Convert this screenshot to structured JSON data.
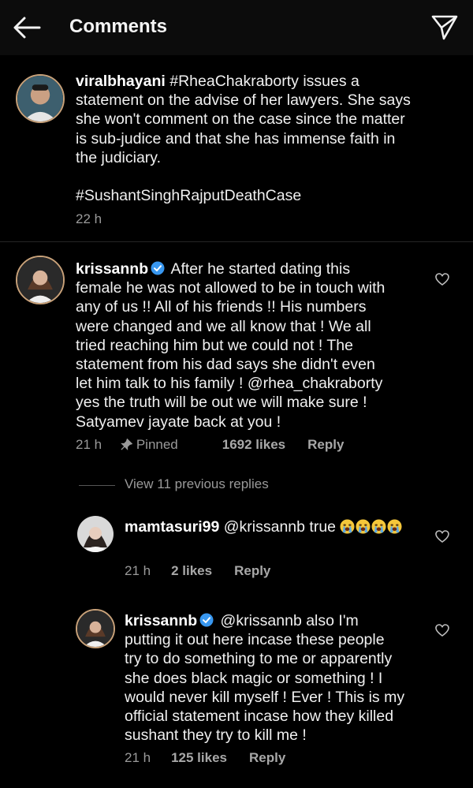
{
  "header": {
    "title": "Comments",
    "back_icon": "arrow-left-icon",
    "send_icon": "paper-plane-icon"
  },
  "caption": {
    "username": "viralbhayani",
    "text": "#RheaChakraborty issues a\nstatement on the advise of her lawyers. She says\nshe won't comment on the case since the matter\nis sub-judice and that she has immense faith in\nthe judiciary.\n\n#SushantSinghRajputDeathCase",
    "time": "22 h"
  },
  "comments": [
    {
      "username": "krissannb",
      "verified": true,
      "text": "After he started dating this\nfemale he was not allowed to be in touch with\nany of us !! All of his friends !! His numbers\nwere changed and we all know that ! We all\ntried reaching him but we could not ! The\nstatement from his dad says she didn't even\nlet him talk to his family ! @rhea_chakraborty\nyes the truth will be out we will make sure !\nSatyamev jayate back at you !",
      "time": "21 h",
      "pinned_label": "Pinned",
      "likes": "1692 likes",
      "reply_label": "Reply"
    }
  ],
  "view_replies_label": "View 11 previous replies",
  "replies": [
    {
      "username": "mamtasuri99",
      "text": "@krissannb true",
      "emoji_count": 4,
      "time": "21 h",
      "likes": "2 likes",
      "reply_label": "Reply"
    },
    {
      "username": "krissannb",
      "verified": true,
      "text": "@krissannb also I'm\nputting it out here incase these people\ntry to do something to me or apparently\nshe does black magic or something ! I\nwould never kill myself ! Ever ! This is my\nofficial statement incase how they killed\nsushant they try to kill me !",
      "time": "21 h",
      "likes": "125 likes",
      "reply_label": "Reply"
    }
  ],
  "colors": {
    "background": "#000000",
    "header": "#0c0c0c",
    "secondary_text": "#9a9a9a",
    "verified": "#3897f0"
  }
}
